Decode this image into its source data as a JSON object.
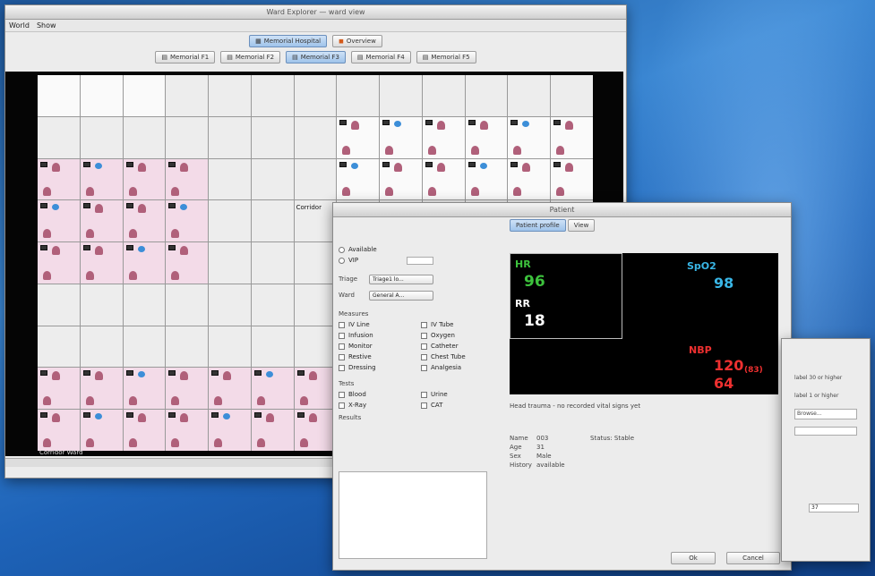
{
  "main_window": {
    "title": "Ward Explorer — ward view",
    "menu": [
      "World",
      "Show"
    ],
    "hospital_buttons": [
      {
        "label": "Memorial Hospital",
        "active": true
      },
      {
        "label": "Overview",
        "active": false
      }
    ],
    "floor_tabs": [
      "Memorial F1",
      "Memorial F2",
      "Memorial F3",
      "Memorial F4",
      "Memorial F5"
    ],
    "active_floor_index": 2,
    "corridor_label": "Corridor",
    "footer_label": "Corridor Ward"
  },
  "dialog": {
    "title": "Patient",
    "tabs": [
      "Patient profile",
      "View"
    ],
    "status_options": [
      "Available",
      "VIP"
    ],
    "fields": [
      {
        "label": "Triage",
        "value": "Triage1 lo..."
      },
      {
        "label": "Ward",
        "value": "General A..."
      }
    ],
    "measures_title": "Measures",
    "measures_left": [
      "IV Line",
      "Infusion",
      "Monitor",
      "Restive",
      "Dressing"
    ],
    "measures_right": [
      "IV Tube",
      "Oxygen",
      "Catheter",
      "Chest Tube",
      "Analgesia"
    ],
    "tests_title": "Tests",
    "tests_left": [
      "Blood",
      "X-Ray"
    ],
    "tests_right": [
      "Urine",
      "CAT"
    ],
    "notes_label": "Results",
    "vitals": {
      "hr_label": "HR",
      "hr_value": "96",
      "rr_label": "RR",
      "rr_value": "18",
      "spo2_label": "SpO2",
      "spo2_value": "98",
      "nbp_label": "NBP",
      "nbp_sys": "120",
      "nbp_unit": "(83)",
      "nbp_dia": "64"
    },
    "description": "Head trauma - no recorded vital signs yet",
    "patient_info": [
      {
        "label": "Name",
        "value": "003",
        "extra_label": "Status",
        "extra_value": "Stable"
      },
      {
        "label": "Age",
        "value": "31"
      },
      {
        "label": "Sex",
        "value": "Male"
      },
      {
        "label": "History",
        "value": "available"
      }
    ],
    "ok_label": "Ok",
    "cancel_label": "Cancel"
  },
  "side_window": {
    "lines": [
      "label 30 or higher",
      "label 1 or higher",
      "Browse..."
    ],
    "value": "37"
  }
}
